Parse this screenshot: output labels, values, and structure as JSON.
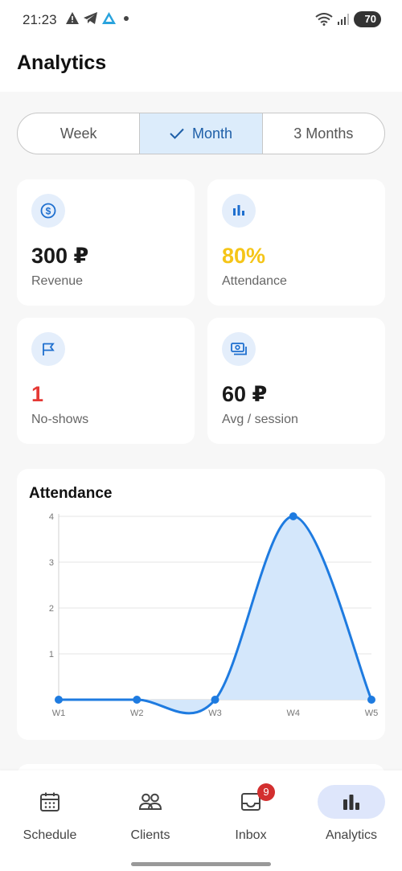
{
  "status_bar": {
    "time": "21:23",
    "battery": "70"
  },
  "header": {
    "title": "Analytics"
  },
  "period": {
    "options": [
      "Week",
      "Month",
      "3 Months"
    ],
    "selected": "Month"
  },
  "stats": {
    "revenue": {
      "value": "300 ₽",
      "label": "Revenue",
      "icon": "dollar-circle-icon"
    },
    "attendance": {
      "value": "80%",
      "label": "Attendance",
      "icon": "bar-chart-icon",
      "color": "#f5c518"
    },
    "no_shows": {
      "value": "1",
      "label": "No-shows",
      "icon": "flag-icon",
      "color": "#e53935"
    },
    "avg_session": {
      "value": "60 ₽",
      "label": "Avg / session",
      "icon": "cash-icon"
    }
  },
  "chart_data": {
    "type": "area",
    "title": "Attendance",
    "categories": [
      "W1",
      "W2",
      "W3",
      "W4",
      "W5"
    ],
    "values": [
      0,
      0,
      0,
      4,
      0
    ],
    "yticks": [
      "1",
      "2",
      "3",
      "4"
    ],
    "ylim": [
      0,
      4
    ],
    "color": "#1e7be0",
    "fill": "#d4e7fb"
  },
  "nav": {
    "items": [
      {
        "label": "Schedule",
        "icon": "calendar-icon"
      },
      {
        "label": "Clients",
        "icon": "people-icon"
      },
      {
        "label": "Inbox",
        "icon": "inbox-icon",
        "badge": "9"
      },
      {
        "label": "Analytics",
        "icon": "bar-chart-icon",
        "active": true
      }
    ]
  }
}
